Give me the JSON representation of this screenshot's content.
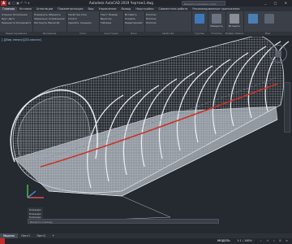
{
  "titlebar": {
    "logo": "A",
    "qat": "◧ ▢ ▣ ↶ ↷ ▾",
    "title": "Autodesk AutoCAD 2019  Чертеж1.dwg",
    "search_placeholder": "Введите ключевое слово",
    "window_controls": "_ ▢ ✕"
  },
  "tabs": [
    "Главная",
    "Вставка",
    "Аннотации",
    "Параметризация",
    "Вид",
    "Управление",
    "Вывод",
    "Надстройки",
    "Совместная работа",
    "Рекомендованные приложения"
  ],
  "ribbon": {
    "panels": [
      {
        "title": "Редактирование",
        "rows": [
          "Отрезок  Полилиния",
          "Круг  Дуга",
          "Перенести  Копировать"
        ]
      },
      {
        "title": "Рисование",
        "rows": [
          "Повернуть  Обрезать",
          "Зеркально  Сопряжение",
          "Растянуть  Масштаб"
        ]
      },
      {
        "title": "Слои",
        "rows": [
          "Свойства слоя",
          "Слой 0",
          "Сделать текущим"
        ]
      },
      {
        "title": "Аннотации",
        "rows": [
          "Текст  Размер",
          "Выноска",
          "Таблица"
        ]
      },
      {
        "title": "Блок",
        "rows": [
          "Вставить",
          "Создать",
          "Редактировать"
        ]
      },
      {
        "title": "Свойства",
        "rows": [
          "ПоСлою",
          "ПоСлою",
          "ПоСлою"
        ]
      },
      {
        "title": "Группы",
        "rows": [
          "Группа",
          "Разгруппировать"
        ]
      },
      {
        "title": "Утилиты",
        "rows": [
          "Измерить",
          "Выбрать"
        ]
      },
      {
        "title": "Буфер обмена",
        "rows": [
          "Вставить"
        ]
      },
      {
        "title": "Вид",
        "rows": [
          "Базовый"
        ]
      }
    ],
    "insert_label": "Вставить",
    "measure_label": "Измерить",
    "clipboard_label": "Буфер обмена"
  },
  "viewport": {
    "label": "[-][Вид сверху][2D-каркас]",
    "colors": {
      "background": "#252930",
      "mesh": "#c9ced6",
      "red_line": "#c8332a",
      "floor": "#8f959d"
    }
  },
  "command": {
    "history": [
      "Команда:",
      "Команда:",
      "Команда:"
    ],
    "placeholder": "Введите команду"
  },
  "layouts": [
    "Модель",
    "Лист1",
    "Лист2",
    "+"
  ],
  "statusbar": {
    "model": "МОДЕЛЬ",
    "scale": "1:1 / 100%",
    "icons": "# ⋮ ∟ ⊙ ⌖ ⚙ ≡"
  }
}
